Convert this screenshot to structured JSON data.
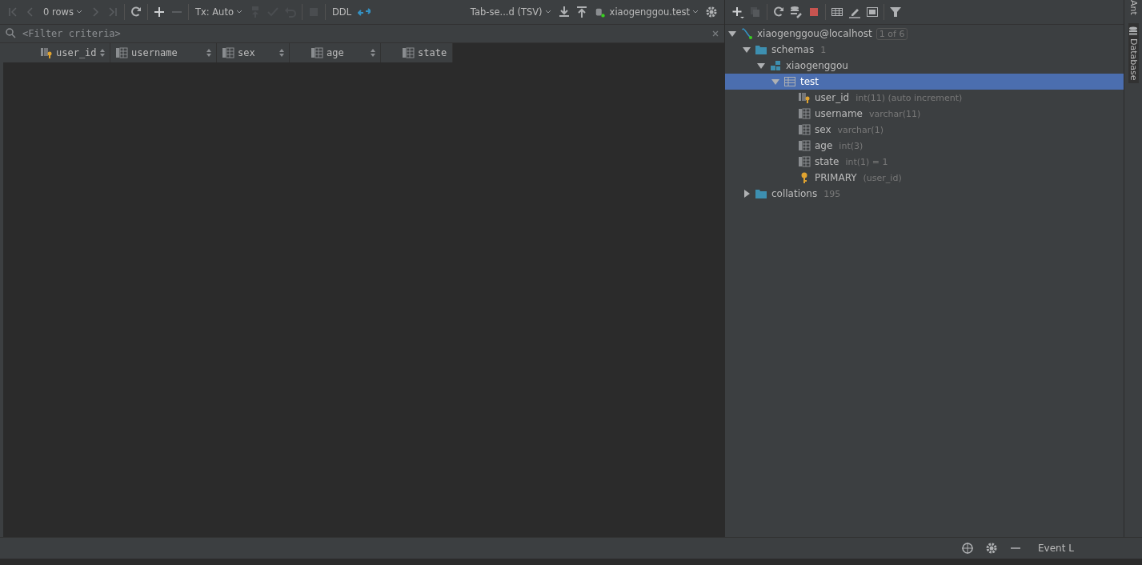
{
  "editor_toolbar": {
    "rows_label": "0 rows",
    "tx_label": "Tx: Auto",
    "ddl_label": "DDL",
    "export_format": "Tab-se...d (TSV)",
    "session": "xiaogenggou.test"
  },
  "filter": {
    "placeholder": "<Filter criteria>"
  },
  "table": {
    "columns": [
      {
        "name": "user_id",
        "kind": "key"
      },
      {
        "name": "username",
        "kind": "column"
      },
      {
        "name": "sex",
        "kind": "column"
      },
      {
        "name": "age",
        "kind": "column"
      },
      {
        "name": "state",
        "kind": "column"
      }
    ]
  },
  "database_tree": {
    "children": [
      {
        "label": "xiaogenggou@localhost",
        "kind": "datasource",
        "badge": "1 of 6",
        "expanded": true,
        "selected": false,
        "children": [
          {
            "label": "schemas",
            "kind": "folder",
            "count": "1",
            "expanded": true,
            "selected": false,
            "children": [
              {
                "label": "xiaogenggou",
                "kind": "schema",
                "expanded": true,
                "selected": false,
                "children": [
                  {
                    "label": "test",
                    "kind": "table",
                    "expanded": true,
                    "selected": true,
                    "children": [
                      {
                        "label": "user_id",
                        "kind": "key-column",
                        "detail": "int(11) (auto increment)",
                        "selected": false
                      },
                      {
                        "label": "username",
                        "kind": "column",
                        "detail": "varchar(11)",
                        "selected": false
                      },
                      {
                        "label": "sex",
                        "kind": "column",
                        "detail": "varchar(1)",
                        "selected": false
                      },
                      {
                        "label": "age",
                        "kind": "column",
                        "detail": "int(3)",
                        "selected": false
                      },
                      {
                        "label": "state",
                        "kind": "column",
                        "detail": "int(1) = 1",
                        "selected": false
                      },
                      {
                        "label": "PRIMARY",
                        "kind": "index",
                        "detail": "(user_id)",
                        "selected": false
                      }
                    ]
                  }
                ]
              }
            ]
          },
          {
            "label": "collations",
            "kind": "folder",
            "count": "195",
            "expanded": false,
            "selected": false
          }
        ]
      }
    ]
  },
  "side_tabs": [
    "Ant",
    "Database"
  ],
  "status_bar": {
    "event_log": "Event L"
  }
}
